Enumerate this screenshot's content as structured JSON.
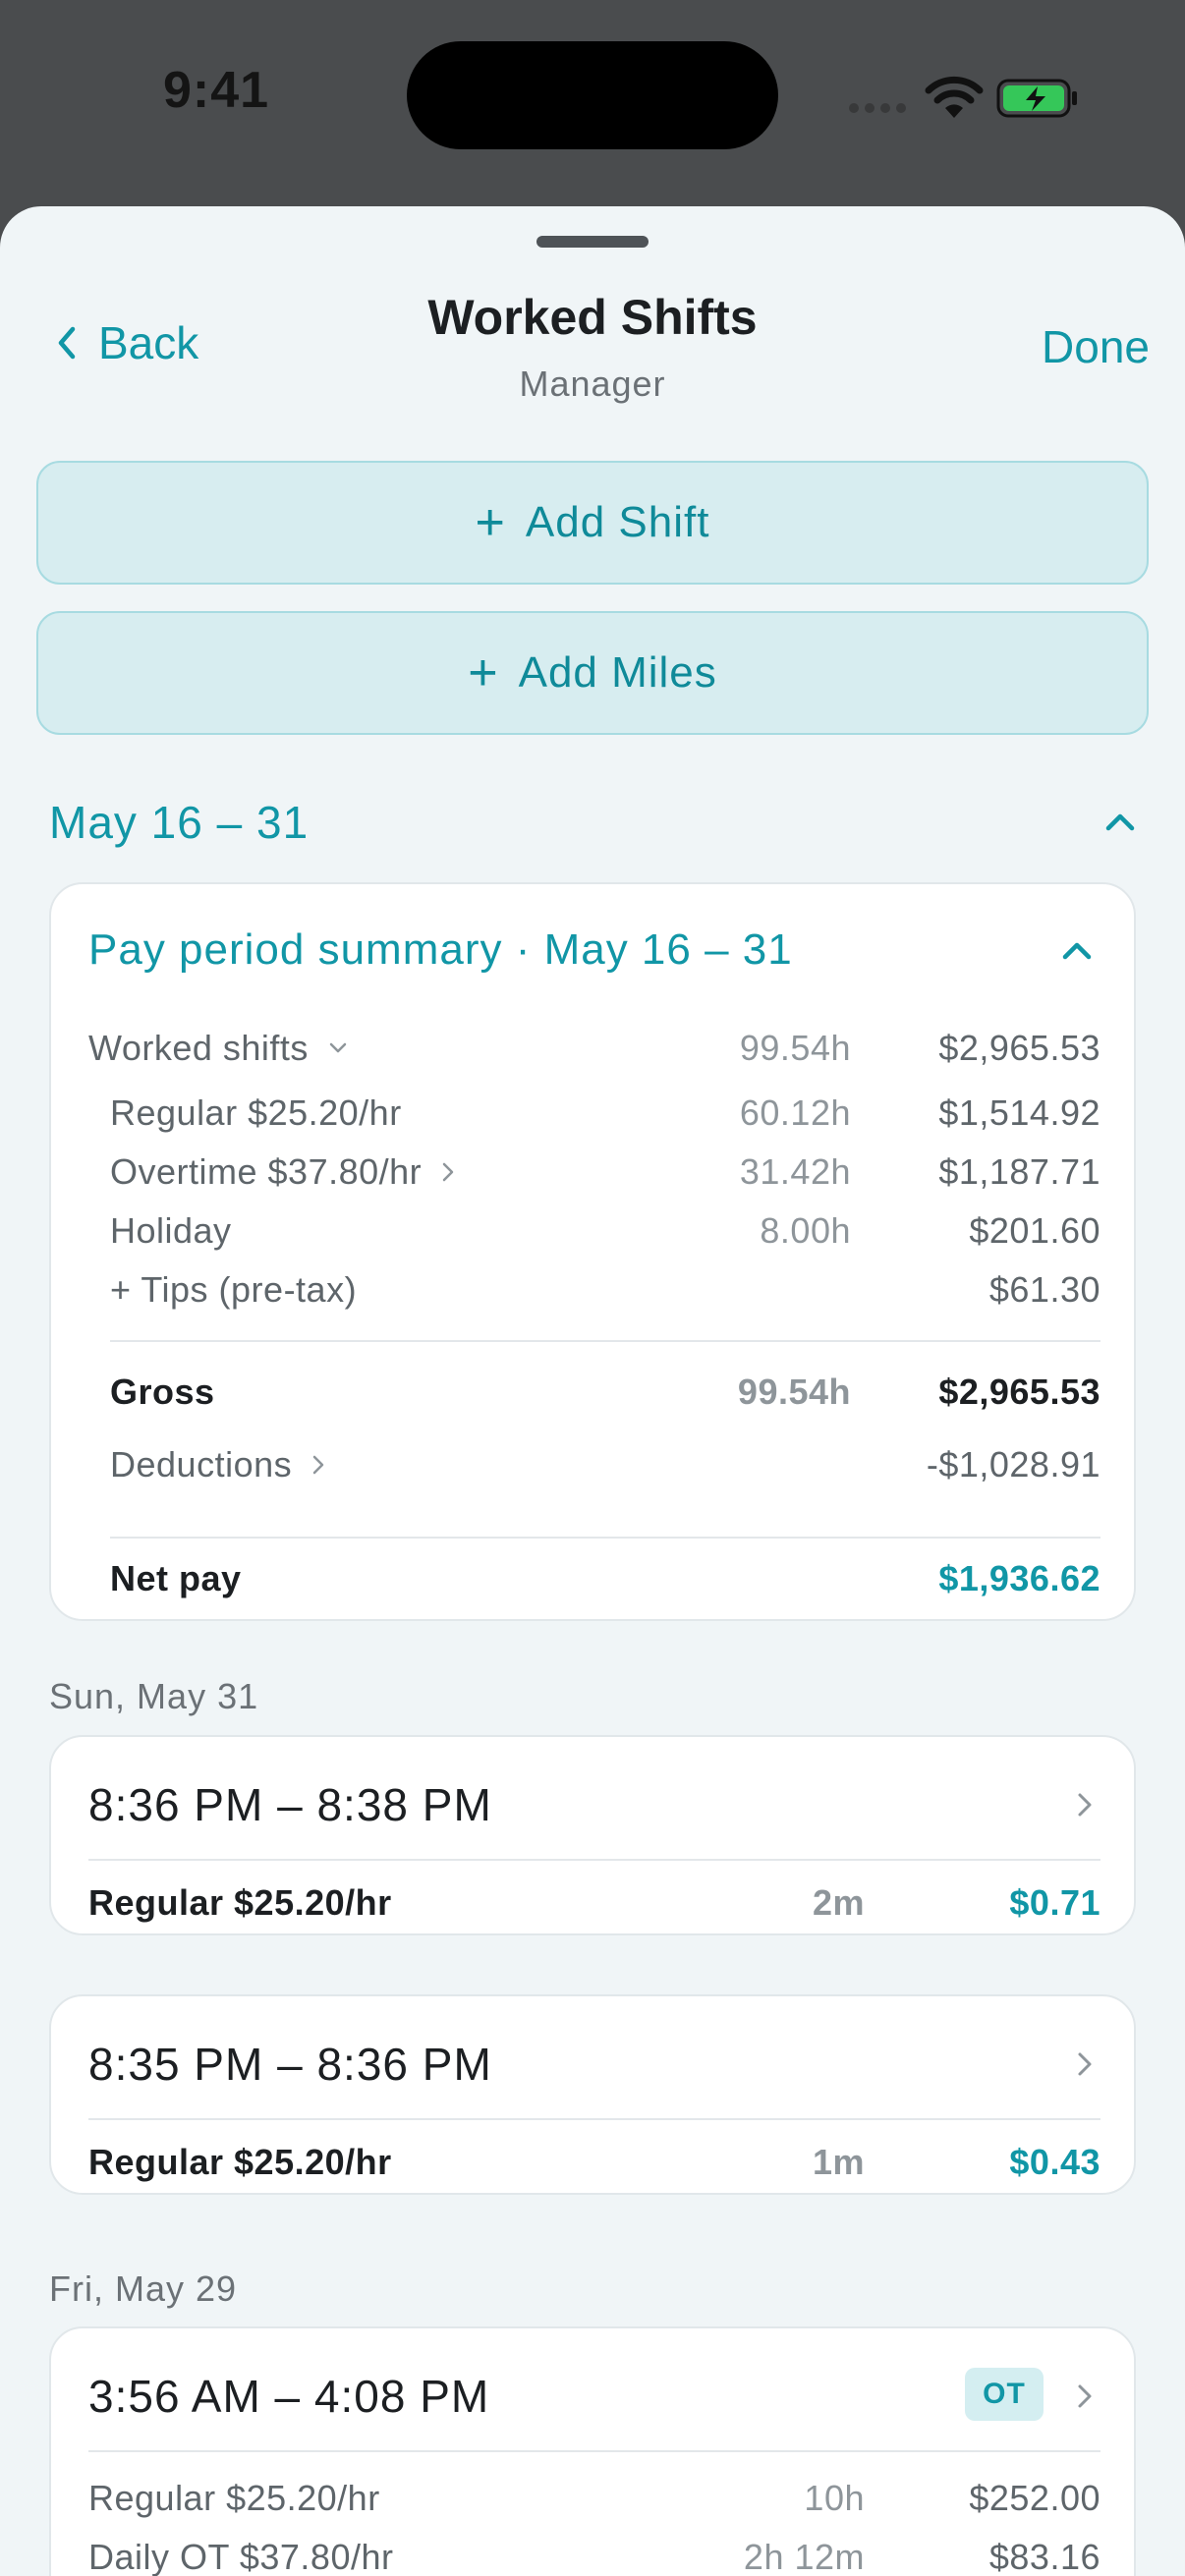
{
  "status": {
    "time": "9:41"
  },
  "nav": {
    "back_label": "Back",
    "title": "Worked Shifts",
    "subtitle": "Manager",
    "done_label": "Done"
  },
  "actions": {
    "add_shift": "Add Shift",
    "add_miles": "Add Miles",
    "plus": "+"
  },
  "period": {
    "label": "May 16 – 31"
  },
  "summary": {
    "title": "Pay period summary · May 16 – 31",
    "rows": [
      {
        "label": "Worked shifts",
        "hours": "99.54h",
        "amount": "$2,965.53"
      },
      {
        "label": "Regular $25.20/hr",
        "hours": "60.12h",
        "amount": "$1,514.92"
      },
      {
        "label": "Overtime $37.80/hr",
        "hours": "31.42h",
        "amount": "$1,187.71"
      },
      {
        "label": "Holiday",
        "hours": "8.00h",
        "amount": "$201.60"
      },
      {
        "label": "+ Tips (pre-tax)",
        "hours": "",
        "amount": "$61.30"
      },
      {
        "label": "Gross",
        "hours": "99.54h",
        "amount": "$2,965.53"
      },
      {
        "label": "Deductions",
        "hours": "",
        "amount": "-$1,028.91"
      },
      {
        "label": "Net pay",
        "hours": "",
        "amount": "$1,936.62"
      }
    ]
  },
  "days": [
    {
      "label": "Sun, May 31",
      "shifts": [
        {
          "time": "8:36 PM – 8:38 PM",
          "rate": "Regular $25.20/hr",
          "duration": "2m",
          "amount": "$0.71"
        },
        {
          "time": "8:35 PM – 8:36 PM",
          "rate": "Regular $25.20/hr",
          "duration": "1m",
          "amount": "$0.43"
        }
      ]
    },
    {
      "label": "Fri, May 29",
      "shifts": [
        {
          "time": "3:56 AM – 4:08 PM",
          "badge": "OT",
          "lines": [
            {
              "rate": "Regular $25.20/hr",
              "duration": "10h",
              "amount": "$252.00"
            },
            {
              "rate": "Daily OT $37.80/hr",
              "duration": "2h 12m",
              "amount": "$83.16"
            }
          ]
        }
      ]
    }
  ],
  "colors": {
    "accent": "#1196a6",
    "sheet_bg": "#f0f5f7",
    "button_bg": "#d7edf0"
  }
}
